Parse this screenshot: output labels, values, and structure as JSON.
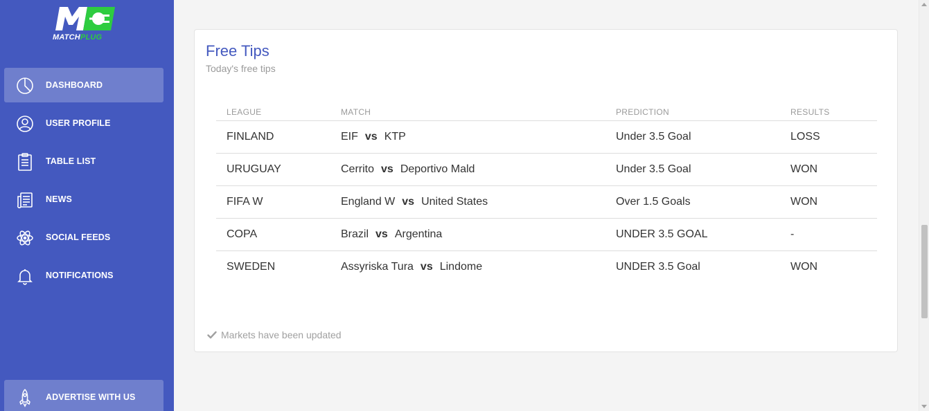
{
  "brand": {
    "logo_part1": "MATCH",
    "logo_part2": "PLUG",
    "accent_color": "#2ecc40",
    "sidebar_color": "#4459bf"
  },
  "sidebar": {
    "items": [
      {
        "label": "DASHBOARD",
        "icon": "pie-chart-icon",
        "active": true
      },
      {
        "label": "USER PROFILE",
        "icon": "user-icon",
        "active": false
      },
      {
        "label": "TABLE LIST",
        "icon": "clipboard-icon",
        "active": false
      },
      {
        "label": "NEWS",
        "icon": "newspaper-icon",
        "active": false
      },
      {
        "label": "SOCIAL FEEDS",
        "icon": "atom-icon",
        "active": false
      },
      {
        "label": "NOTIFICATIONS",
        "icon": "bell-icon",
        "active": false
      }
    ],
    "bottom_item": {
      "label": "ADVERTISE WITH US",
      "icon": "rocket-icon"
    }
  },
  "card": {
    "title": "Free Tips",
    "subtitle": "Today's free tips",
    "footer": "Markets have been updated",
    "footer_icon": "check-icon"
  },
  "table": {
    "headers": [
      "LEAGUE",
      "MATCH",
      "PREDICTION",
      "RESULTS"
    ],
    "vs_label": "vs",
    "rows": [
      {
        "league": "FINLAND",
        "home": "EIF",
        "away": "KTP",
        "prediction": "Under 3.5 Goal",
        "result": "LOSS"
      },
      {
        "league": "URUGUAY",
        "home": "Cerrito",
        "away": "Deportivo Mald",
        "prediction": "Under 3.5 Goal",
        "result": "WON"
      },
      {
        "league": "FIFA W",
        "home": "England W",
        "away": "United States",
        "prediction": "Over 1.5 Goals",
        "result": "WON"
      },
      {
        "league": "COPA",
        "home": "Brazil",
        "away": "Argentina",
        "prediction": "UNDER 3.5 GOAL",
        "result": "-"
      },
      {
        "league": "SWEDEN",
        "home": "Assyriska Tura",
        "away": "Lindome",
        "prediction": "UNDER 3.5 Goal",
        "result": "WON"
      }
    ]
  }
}
